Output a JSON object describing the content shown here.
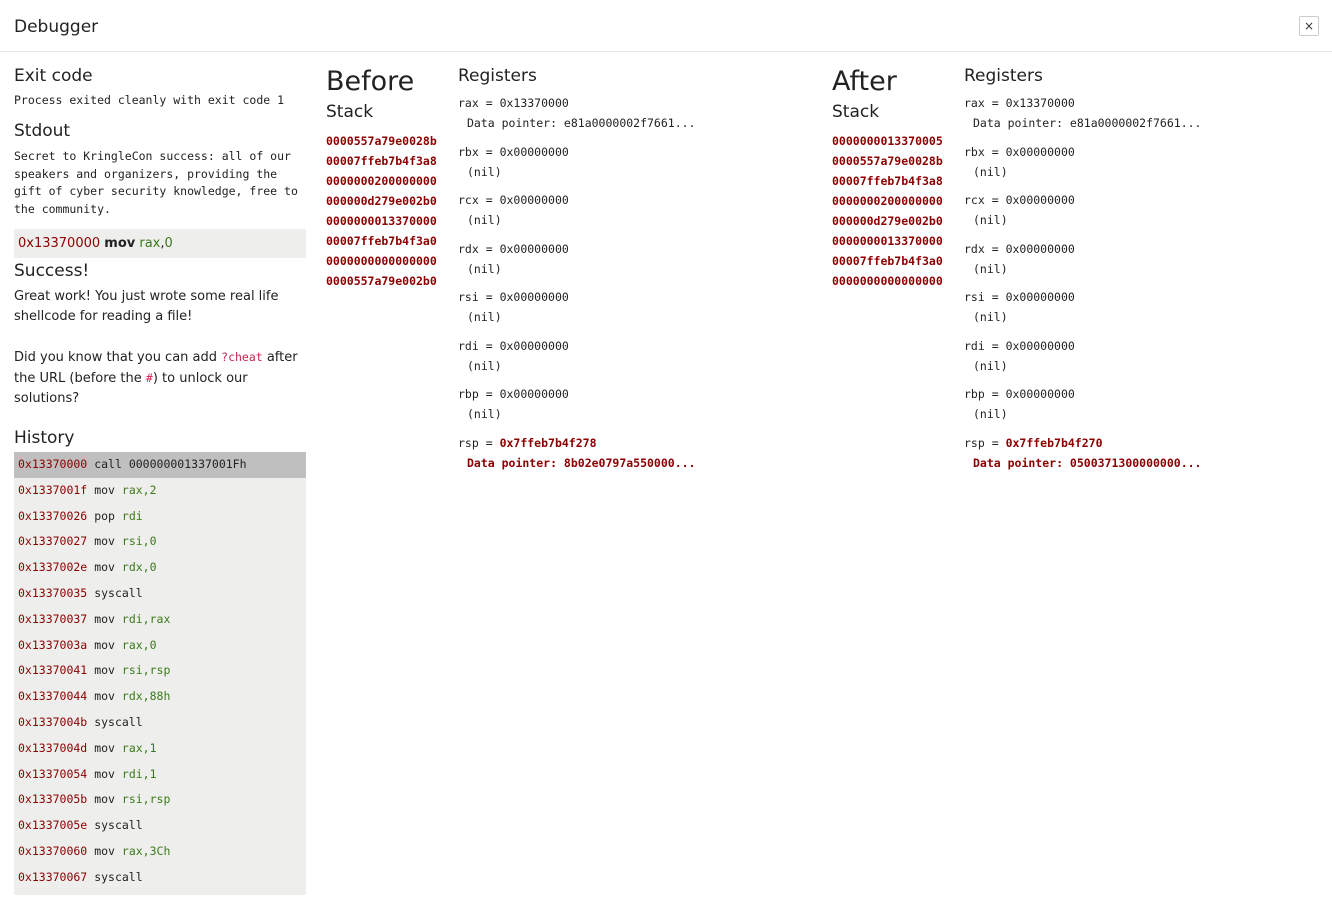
{
  "window": {
    "title": "Debugger",
    "close_label": "×"
  },
  "exit_code": {
    "title": "Exit code",
    "text": "Process exited cleanly with exit code 1"
  },
  "stdout": {
    "title": "Stdout",
    "text": "Secret to KringleCon success: all of our speakers and organizers, providing the gift of cyber security knowledge, free to the community."
  },
  "current_instruction": {
    "addr": "0x13370000",
    "mnemonic": "mov",
    "op1": "rax",
    "sep": ",",
    "op2": "0"
  },
  "success": {
    "title": "Success!",
    "line1": "Great work! You just wrote some real life shellcode for reading a file!",
    "line2_a": "Did you know that you can add ",
    "line2_code": "?cheat",
    "line2_b": " after the URL (before the ",
    "line2_hash": "#",
    "line2_c": ") to unlock our solutions?"
  },
  "history": {
    "title": "History",
    "items": [
      {
        "addr": "0x13370000",
        "mnem": "call",
        "ops": "000000001337001Fh",
        "active": true
      },
      {
        "addr": "0x1337001f",
        "mnem": "mov",
        "ops": "rax,2"
      },
      {
        "addr": "0x13370026",
        "mnem": "pop",
        "ops": "rdi"
      },
      {
        "addr": "0x13370027",
        "mnem": "mov",
        "ops": "rsi,0"
      },
      {
        "addr": "0x1337002e",
        "mnem": "mov",
        "ops": "rdx,0"
      },
      {
        "addr": "0x13370035",
        "mnem": "syscall",
        "ops": ""
      },
      {
        "addr": "0x13370037",
        "mnem": "mov",
        "ops": "rdi,rax"
      },
      {
        "addr": "0x1337003a",
        "mnem": "mov",
        "ops": "rax,0"
      },
      {
        "addr": "0x13370041",
        "mnem": "mov",
        "ops": "rsi,rsp"
      },
      {
        "addr": "0x13370044",
        "mnem": "mov",
        "ops": "rdx,88h"
      },
      {
        "addr": "0x1337004b",
        "mnem": "syscall",
        "ops": ""
      },
      {
        "addr": "0x1337004d",
        "mnem": "mov",
        "ops": "rax,1"
      },
      {
        "addr": "0x13370054",
        "mnem": "mov",
        "ops": "rdi,1"
      },
      {
        "addr": "0x1337005b",
        "mnem": "mov",
        "ops": "rsi,rsp"
      },
      {
        "addr": "0x1337005e",
        "mnem": "syscall",
        "ops": ""
      },
      {
        "addr": "0x13370060",
        "mnem": "mov",
        "ops": "rax,3Ch"
      },
      {
        "addr": "0x13370067",
        "mnem": "syscall",
        "ops": ""
      }
    ]
  },
  "before": {
    "title": "Before",
    "stack_title": "Stack",
    "registers_title": "Registers",
    "stack": [
      "0000557a79e0028b",
      "00007ffeb7b4f3a8",
      "0000000200000000",
      "000000d279e002b0",
      "0000000013370000",
      "00007ffeb7b4f3a0",
      "0000000000000000",
      "0000557a79e002b0"
    ],
    "registers": [
      {
        "name": "rax",
        "value": "0x13370000",
        "sub": "Data pointer: e81a0000002f7661...",
        "changed": false
      },
      {
        "name": "rbx",
        "value": "0x00000000",
        "sub": "(nil)",
        "changed": false
      },
      {
        "name": "rcx",
        "value": "0x00000000",
        "sub": "(nil)",
        "changed": false
      },
      {
        "name": "rdx",
        "value": "0x00000000",
        "sub": "(nil)",
        "changed": false
      },
      {
        "name": "rsi",
        "value": "0x00000000",
        "sub": "(nil)",
        "changed": false
      },
      {
        "name": "rdi",
        "value": "0x00000000",
        "sub": "(nil)",
        "changed": false
      },
      {
        "name": "rbp",
        "value": "0x00000000",
        "sub": "(nil)",
        "changed": false
      },
      {
        "name": "rsp",
        "value": "0x7ffeb7b4f278",
        "sub": "Data pointer: 8b02e0797a550000...",
        "changed": true
      }
    ]
  },
  "after": {
    "title": "After",
    "stack_title": "Stack",
    "registers_title": "Registers",
    "stack": [
      "0000000013370005",
      "0000557a79e0028b",
      "00007ffeb7b4f3a8",
      "0000000200000000",
      "000000d279e002b0",
      "0000000013370000",
      "00007ffeb7b4f3a0",
      "0000000000000000"
    ],
    "registers": [
      {
        "name": "rax",
        "value": "0x13370000",
        "sub": "Data pointer: e81a0000002f7661...",
        "changed": false
      },
      {
        "name": "rbx",
        "value": "0x00000000",
        "sub": "(nil)",
        "changed": false
      },
      {
        "name": "rcx",
        "value": "0x00000000",
        "sub": "(nil)",
        "changed": false
      },
      {
        "name": "rdx",
        "value": "0x00000000",
        "sub": "(nil)",
        "changed": false
      },
      {
        "name": "rsi",
        "value": "0x00000000",
        "sub": "(nil)",
        "changed": false
      },
      {
        "name": "rdi",
        "value": "0x00000000",
        "sub": "(nil)",
        "changed": false
      },
      {
        "name": "rbp",
        "value": "0x00000000",
        "sub": "(nil)",
        "changed": false
      },
      {
        "name": "rsp",
        "value": "0x7ffeb7b4f270",
        "sub": "Data pointer: 0500371300000000...",
        "changed": true
      }
    ]
  },
  "colors": {
    "address": "#8b0000",
    "operand": "#3a7a1a",
    "code": "#c7254e",
    "panel": "#eeeeec",
    "active_row": "#bfbfbf"
  }
}
